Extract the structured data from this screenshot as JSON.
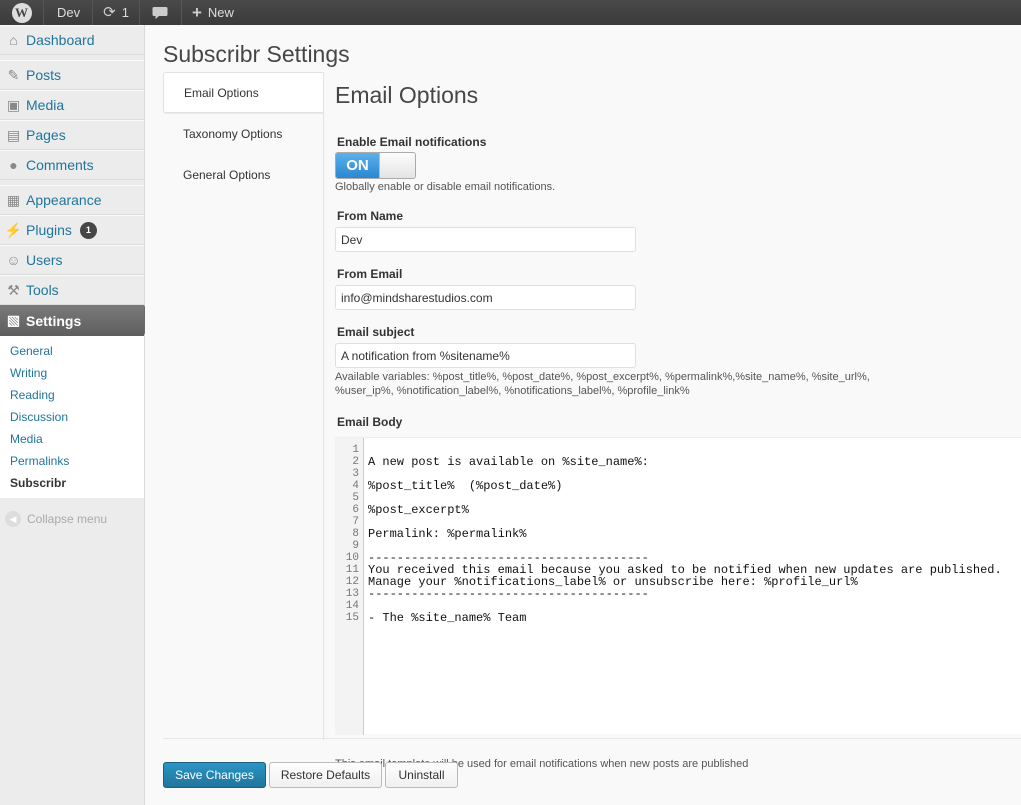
{
  "adminbar": {
    "logo_letter": "W",
    "site_name": "Dev",
    "updates_count": "1",
    "new_label": "New"
  },
  "sidebar": {
    "dashboard": "Dashboard",
    "posts": "Posts",
    "media": "Media",
    "pages": "Pages",
    "comments": "Comments",
    "appearance": "Appearance",
    "plugins": "Plugins",
    "plugins_badge": "1",
    "users": "Users",
    "tools": "Tools",
    "settings": "Settings",
    "submenu": [
      "General",
      "Writing",
      "Reading",
      "Discussion",
      "Media",
      "Permalinks",
      "Subscribr"
    ],
    "collapse": "Collapse menu"
  },
  "page": {
    "title": "Subscribr Settings",
    "tabs": [
      "Email Options",
      "Taxonomy Options",
      "General Options"
    ],
    "section_title": "Email Options"
  },
  "form": {
    "enable_label": "Enable Email notifications",
    "toggle_state": "ON",
    "enable_hint": "Globally enable or disable email notifications.",
    "from_name_label": "From Name",
    "from_name_value": "Dev",
    "from_email_label": "From Email",
    "from_email_value": "info@mindsharestudios.com",
    "subject_label": "Email subject",
    "subject_value": "A notification from %sitename%",
    "vars_hint_1": "Available variables: %post_title%, %post_date%, %post_excerpt%, %permalink%,%site_name%, %site_url%,",
    "vars_hint_2": "%user_ip%, %notification_label%, %notifications_label%, %profile_link%",
    "body_label": "Email Body",
    "body_lines": [
      "",
      "A new post is available on %site_name%:",
      "",
      "%post_title%  (%post_date%)",
      "",
      "%post_excerpt%",
      "",
      "Permalink: %permalink%",
      "",
      "---------------------------------------",
      "You received this email because you asked to be notified when new updates are published.",
      "Manage your %notifications_label% or unsubscribe here: %profile_url%",
      "---------------------------------------",
      "",
      "- The %site_name% Team"
    ],
    "line_numbers": [
      "1",
      "2",
      "3",
      "4",
      "5",
      "6",
      "7",
      "8",
      "9",
      "10",
      "11",
      "12",
      "13",
      "14",
      "15"
    ],
    "template_hint": "This email template will be used for email notifications when new posts are published"
  },
  "buttons": {
    "save": "Save Changes",
    "restore": "Restore Defaults",
    "uninstall": "Uninstall"
  },
  "colors": {
    "link": "#21759b",
    "primary_button": "#21759b",
    "toggle_on": "#2b87d0"
  },
  "icons": [
    "wordpress-icon",
    "refresh-icon",
    "comment-icon",
    "plus-icon",
    "dashboard-icon",
    "pin-icon",
    "media-icon",
    "pages-icon",
    "comments-icon",
    "appearance-icon",
    "plugins-icon",
    "users-icon",
    "tools-icon",
    "settings-icon",
    "collapse-icon"
  ]
}
